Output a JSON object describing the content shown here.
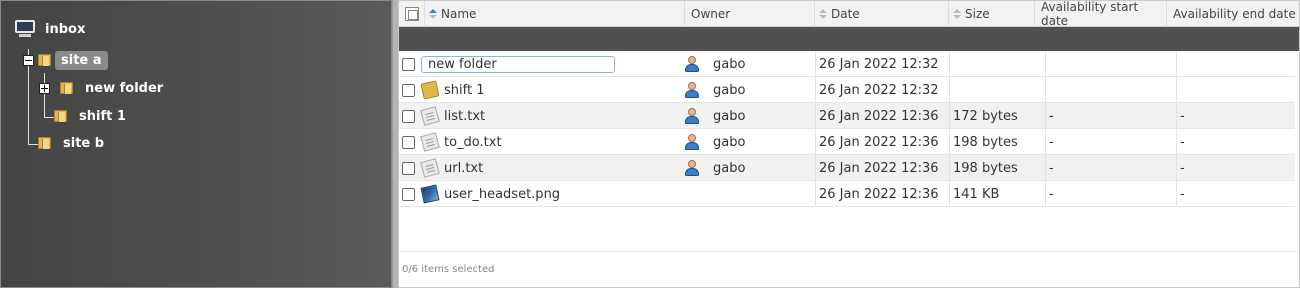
{
  "tree": {
    "root": {
      "label": "inbox",
      "icon": "computer-icon"
    },
    "nodes": [
      {
        "label": "site a",
        "selected": true,
        "expanded": true,
        "icon": "folder-icon"
      },
      {
        "label": "new folder",
        "expandable": true,
        "icon": "folder-icon"
      },
      {
        "label": "shift 1",
        "icon": "folder-icon"
      },
      {
        "label": "site b",
        "icon": "folder-icon"
      }
    ]
  },
  "list": {
    "columns": {
      "name": "Name",
      "owner": "Owner",
      "date": "Date",
      "size": "Size",
      "avail_start": "Availability start date",
      "avail_end": "Availability end date"
    },
    "rows": [
      {
        "name": "new folder",
        "editing": true,
        "icon": "folder-icon",
        "owner": "gabo",
        "date": "26 Jan 2022 12:32",
        "size": "",
        "avail_start": "",
        "avail_end": ""
      },
      {
        "name": "shift 1",
        "icon": "folder-icon",
        "owner": "gabo",
        "date": "26 Jan 2022 12:32",
        "size": "",
        "avail_start": "",
        "avail_end": ""
      },
      {
        "name": "list.txt",
        "icon": "text-file-icon",
        "owner": "gabo",
        "date": "26 Jan 2022 12:36",
        "size": "172 bytes",
        "avail_start": "-",
        "avail_end": "-"
      },
      {
        "name": "to_do.txt",
        "icon": "text-file-icon",
        "owner": "gabo",
        "date": "26 Jan 2022 12:36",
        "size": "198 bytes",
        "avail_start": "-",
        "avail_end": "-"
      },
      {
        "name": "url.txt",
        "icon": "text-file-icon",
        "owner": "gabo",
        "date": "26 Jan 2022 12:36",
        "size": "198 bytes",
        "avail_start": "-",
        "avail_end": "-"
      },
      {
        "name": "user_headset.png",
        "icon": "image-file-icon",
        "owner": "",
        "date": "26 Jan 2022 12:36",
        "size": "141 KB",
        "avail_start": "-",
        "avail_end": "-"
      }
    ],
    "status": "0/6 items selected"
  },
  "colors": {
    "tree_bg": "#4a4a4a",
    "tree_selected": "#8a8a8a",
    "header_band": "#505050",
    "row_alt": "#f1f1f1",
    "sort_active": "#3a7ed6"
  }
}
